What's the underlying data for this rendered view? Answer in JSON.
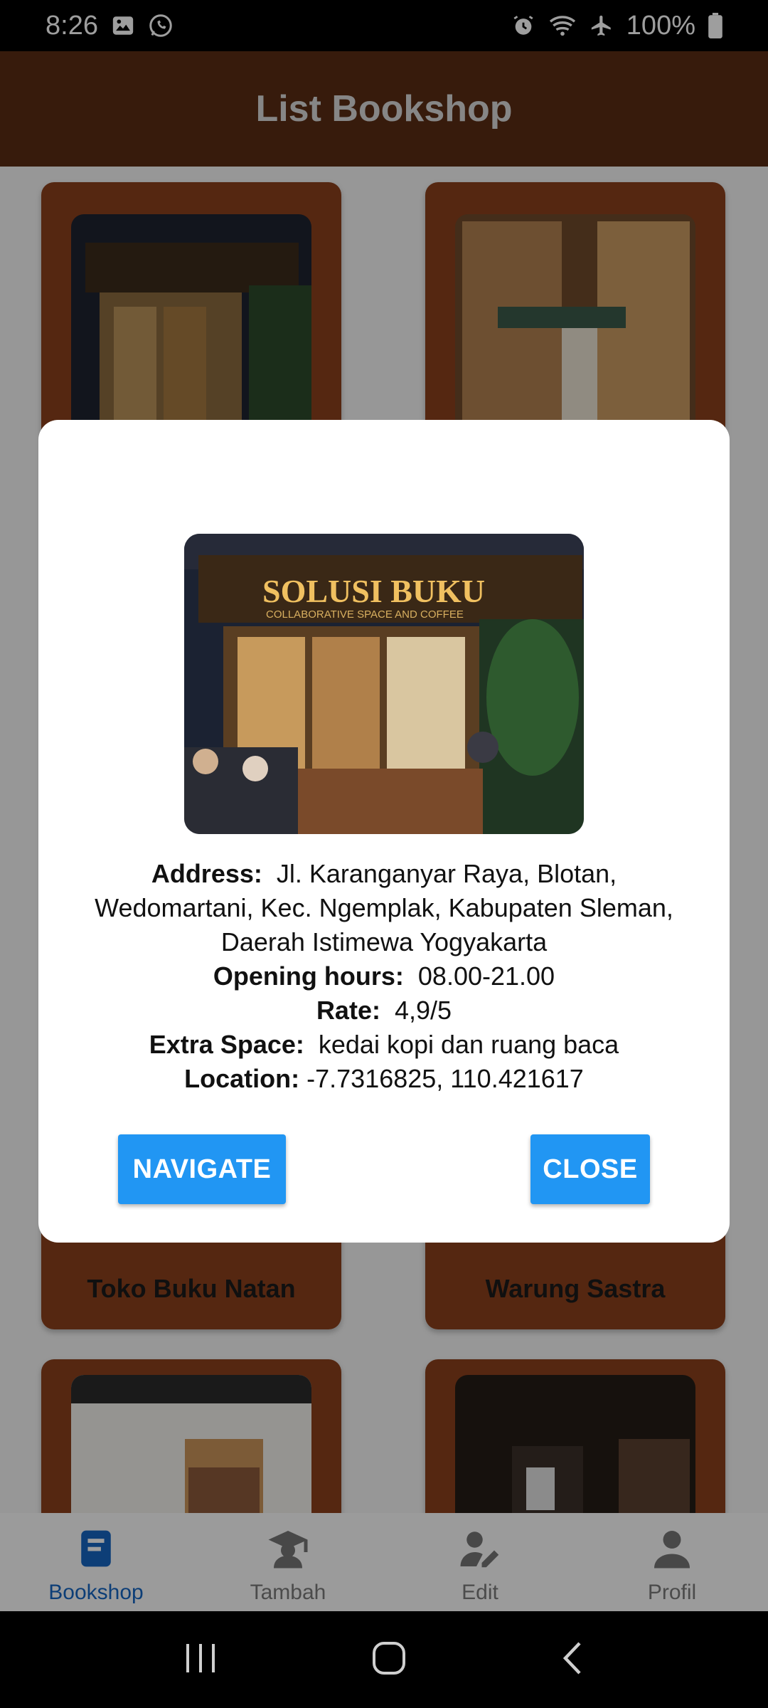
{
  "status_bar": {
    "time": "8:26",
    "battery": "100%"
  },
  "app_bar": {
    "title": "List Bookshop"
  },
  "cards": [
    {
      "title": "Toko Buku Natan"
    },
    {
      "title": "Warung Sastra"
    }
  ],
  "dialog": {
    "address_label": "Address:",
    "address_value": "Jl. Karanganyar Raya, Blotan, Wedomartani, Kec. Ngemplak, Kabupaten Sleman, Daerah Istimewa Yogyakarta",
    "hours_label": "Opening hours:",
    "hours_value": "08.00-21.00",
    "rate_label": "Rate:",
    "rate_value": "4,9/5",
    "extra_label": "Extra Space:",
    "extra_value": "kedai kopi dan ruang baca",
    "location_label": "Location:",
    "location_value": "-7.7316825, 110.421617",
    "navigate_label": "NAVIGATE",
    "close_label": "CLOSE",
    "sign_text": "SOLUSI BUKU",
    "sign_subtext": "COLLABORATIVE SPACE AND COFFEE"
  },
  "bottom_nav": {
    "items": [
      {
        "label": "Bookshop",
        "icon": "book-icon",
        "active": true
      },
      {
        "label": "Tambah",
        "icon": "graduate-icon",
        "active": false
      },
      {
        "label": "Edit",
        "icon": "user-edit-icon",
        "active": false
      },
      {
        "label": "Profil",
        "icon": "person-icon",
        "active": false
      }
    ]
  },
  "colors": {
    "app_bar": "#5a2c14",
    "card": "#8a3f1c",
    "accent_button": "#2196f3",
    "nav_active": "#1565c0"
  }
}
